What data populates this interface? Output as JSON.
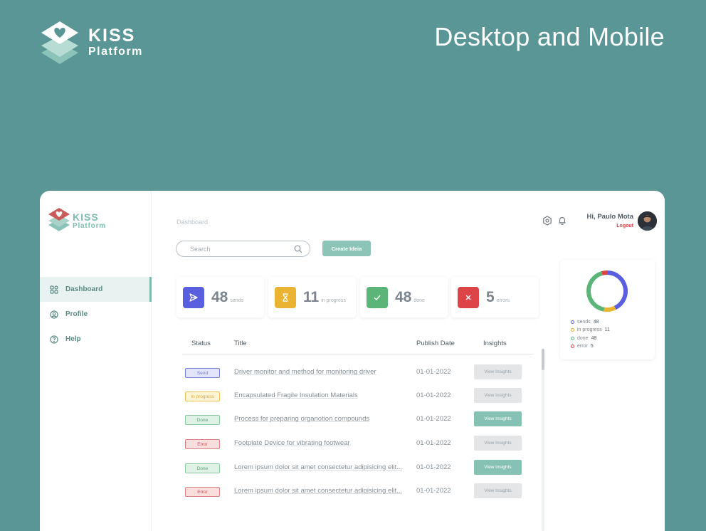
{
  "banner": {
    "brand_line1": "KISS",
    "brand_line2": "Platform",
    "headline": "Desktop and Mobile"
  },
  "sidebar": {
    "brand_line1": "KISS",
    "brand_line2": "Platform",
    "items": [
      {
        "label": "Dashboard",
        "icon": "grid-icon",
        "active": true
      },
      {
        "label": "Profile",
        "icon": "user-circle-icon"
      },
      {
        "label": "Help",
        "icon": "help-circle-icon"
      }
    ]
  },
  "header": {
    "breadcrumb": "Dashboard",
    "greeting": "Hi, Paulo Mota",
    "logout": "Logout"
  },
  "search": {
    "placeholder": "Search"
  },
  "create_button": "Create Ideia",
  "stats": [
    {
      "value": "48",
      "label": "sends",
      "color": "#5a5fe0",
      "icon": "send-icon"
    },
    {
      "value": "11",
      "label": "in progress",
      "color": "#eab331",
      "icon": "hourglass-icon"
    },
    {
      "value": "48",
      "label": "done",
      "color": "#5bb478",
      "icon": "check-icon"
    },
    {
      "value": "5",
      "label": "errors",
      "color": "#dd4448",
      "icon": "x-icon"
    }
  ],
  "table": {
    "headers": {
      "status": "Status",
      "title": "Title",
      "date": "Publish Date",
      "insights": "Insights"
    },
    "rows": [
      {
        "status": "Send",
        "title": "Driver monitor and method for monitoring driver",
        "date": "01-01-2022",
        "insights": "View Insights"
      },
      {
        "status": "In progress",
        "title": "Encapsulated Fragile Insulation Materials",
        "date": "01-01-2022",
        "insights": "View Insights"
      },
      {
        "status": "Done",
        "title": "Process for preparing organotion compounds",
        "date": "01-01-2022",
        "insights": "View Insights"
      },
      {
        "status": "Error",
        "title": "Footplate Device for vibrating footwear",
        "date": "01-01-2022",
        "insights": "View Insights"
      },
      {
        "status": "Done",
        "title": "Lorem ipsum dolor sit amet consectetur adipisicing elit...",
        "date": "01-01-2022",
        "insights": "View Insights"
      },
      {
        "status": "Error",
        "title": "Lorem ipsum dolor sit amet consectetur adipisicing elit...",
        "date": "01-01-2022",
        "insights": "View Insights"
      }
    ]
  },
  "chart_data": {
    "type": "pie",
    "donut": true,
    "legend": "bottom",
    "series": [
      {
        "label": "sends",
        "value": 48,
        "color": "#5a5fe0"
      },
      {
        "label": "in progress",
        "value": 11,
        "color": "#eab331"
      },
      {
        "label": "done",
        "value": 48,
        "color": "#5bb478"
      },
      {
        "label": "error",
        "value": 5,
        "color": "#dd4448"
      }
    ]
  }
}
